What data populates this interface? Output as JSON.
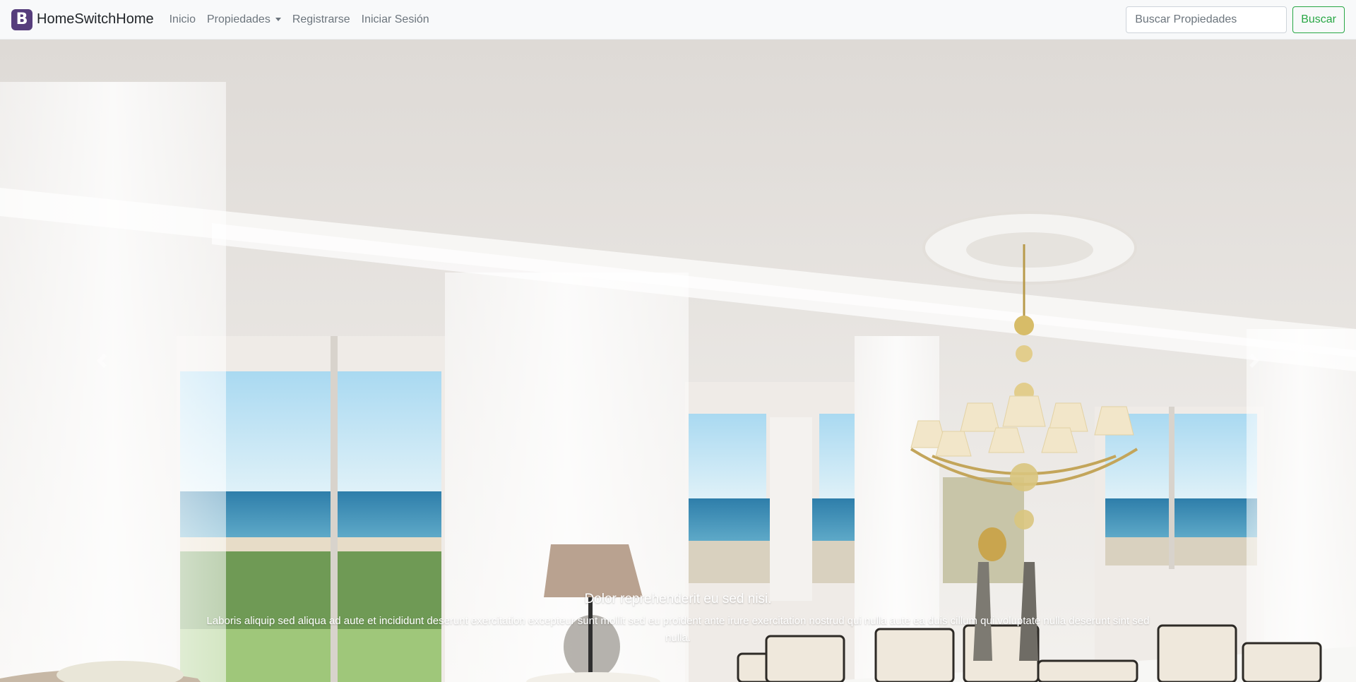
{
  "navbar": {
    "brand_icon": "B",
    "brand_name": "HomeSwitchHome",
    "links": {
      "home": "Inicio",
      "properties": "Propiedades",
      "register": "Registrarse",
      "login": "Iniciar Sesión"
    },
    "search": {
      "placeholder": "Buscar Propiedades",
      "button_label": "Buscar"
    }
  },
  "carousel": {
    "slide": {
      "image": "dining-room-ocean-view",
      "title": "Dolor reprehenderit eu sed nisi.",
      "text": "Laboris aliquip sed aliqua ad aute et incididunt deserunt exercitation excepteur sunt mollit sed eu proident ante irure exercitation nostrud qui nulla aute ea duis cillum qui voluptate nulla deserunt sint sed nulla."
    },
    "controls": {
      "prev_icon": "chevron-left-icon",
      "next_icon": "chevron-right-icon"
    }
  },
  "colors": {
    "brand": "#563d7c",
    "success": "#28a745",
    "navbar_bg": "#f8f9fa"
  }
}
